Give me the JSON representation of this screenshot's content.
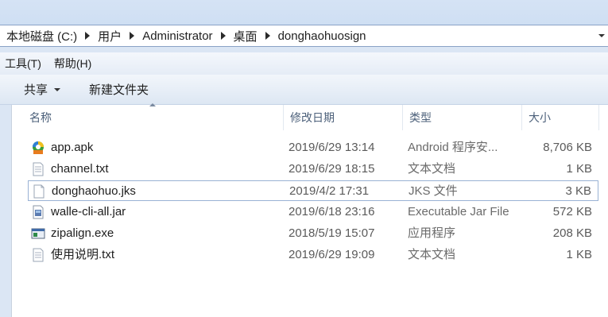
{
  "address": {
    "crumbs": [
      "本地磁盘 (C:)",
      "用户",
      "Administrator",
      "桌面",
      "donghaohuosign"
    ]
  },
  "menu": {
    "items": [
      "工具(T)",
      "帮助(H)"
    ]
  },
  "commands": {
    "share_label": "共享",
    "new_folder_label": "新建文件夹"
  },
  "columns": {
    "name": "名称",
    "date": "修改日期",
    "type": "类型",
    "size": "大小"
  },
  "files": [
    {
      "name": "app.apk",
      "date": "2019/6/29 13:14",
      "type": "Android 程序安...",
      "size": "8,706 KB",
      "icon": "apk-icon"
    },
    {
      "name": "channel.txt",
      "date": "2019/6/29 18:15",
      "type": "文本文档",
      "size": "1 KB",
      "icon": "text-file-icon"
    },
    {
      "name": "donghaohuo.jks",
      "date": "2019/4/2 17:31",
      "type": "JKS 文件",
      "size": "3 KB",
      "icon": "blank-file-icon"
    },
    {
      "name": "walle-cli-all.jar",
      "date": "2019/6/18 23:16",
      "type": "Executable Jar File",
      "size": "572 KB",
      "icon": "jar-file-icon"
    },
    {
      "name": "zipalign.exe",
      "date": "2018/5/19 15:07",
      "type": "应用程序",
      "size": "208 KB",
      "icon": "exe-file-icon"
    },
    {
      "name": "使用说明.txt",
      "date": "2019/6/29 19:09",
      "type": "文本文档",
      "size": "1 KB",
      "icon": "text-file-icon"
    }
  ],
  "selected_file": "donghaohuo.jks"
}
